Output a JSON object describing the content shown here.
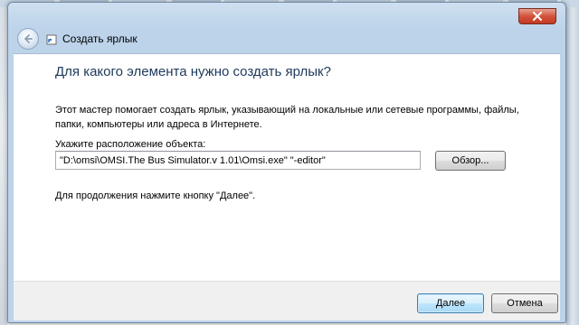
{
  "window": {
    "title": "Создать ярлык"
  },
  "content": {
    "heading": "Для какого элемента нужно создать ярлык?",
    "description": "Этот мастер помогает создать ярлык, указывающий на локальные или сетевые программы, файлы, папки, компьютеры или адреса в Интернете.",
    "location_label": "Укажите расположение объекта:",
    "location_value": "\"D:\\omsi\\OMSI.The Bus Simulator.v 1.01\\Omsi.exe\" \"-editor\"",
    "browse_label": "Обзор...",
    "continue_text": "Для продолжения нажмите кнопку \"Далее\"."
  },
  "footer": {
    "next_label": "Далее",
    "cancel_label": "Отмена"
  },
  "icons": {
    "back": "back-arrow-icon",
    "wizard": "shortcut-wizard-icon",
    "close": "close-icon"
  },
  "colors": {
    "heading": "#1e395b",
    "frame": "#bcd3ea",
    "close": "#c23a22",
    "default_button_border": "#3c7fb1"
  }
}
